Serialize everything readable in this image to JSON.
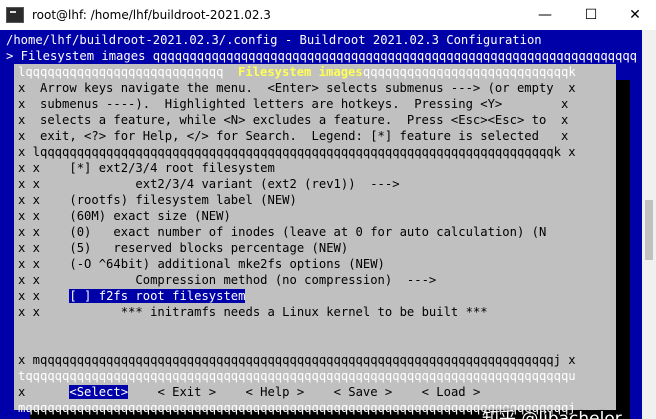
{
  "window": {
    "title": "root@lhf: /home/lhf/buildroot-2021.02.3",
    "min_glyph": "—",
    "max_glyph": "☐",
    "close_glyph": "✕"
  },
  "terminal": {
    "header_line": "/home/lhf/buildroot-2021.02.3/.config - Buildroot 2021.02.3 Configuration",
    "breadcrumb_line": "> Filesystem images qqqqqqqqqqqqqqqqqqqqqqqqqqqqqqqqqqqqqqqqqqqqqqqqqqqqqqqqqqqqqqqqqq"
  },
  "dialog": {
    "top_border_left": "lqqqqqqqqqqqqqqqqqqqqqqqqqqq",
    "title": " Filesystem images ",
    "top_border_right": "qqqqqqqqqqqqqqqqqqqqqqqqqqqqk",
    "help": [
      "x  Arrow keys navigate the menu.  <Enter> selects submenus ---> (or empty  x",
      "x  submenus ----).  Highlighted letters are hotkeys.  Pressing <Y>        x",
      "x  selects a feature, while <N> excludes a feature.  Press <Esc><Esc> to  x",
      "x  exit, <?> for Help, </> for Search.  Legend: [*] feature is selected   x"
    ],
    "inner_top": "x lqqqqqqqqqqqqqqqqqqqqqqqqqqqqqqqqqqqqqqqqqqqqqqqqqqqqqqqqqqqqqqqqqqqqqqk x",
    "items": [
      {
        "marker": "[*]",
        "text": "ext2/3/4 root filesystem"
      },
      {
        "marker": "   ",
        "text": "     ext2/3/4 variant (ext2 (rev1))  --->"
      },
      {
        "marker": "(rootfs)",
        "text": "filesystem label (NEW)"
      },
      {
        "marker": "(60M)",
        "text": "exact size (NEW)"
      },
      {
        "marker": "(0)",
        "text": "  exact number of inodes (leave at 0 for auto calculation) (N"
      },
      {
        "marker": "(5)",
        "text": "  reserved blocks percentage (NEW)"
      },
      {
        "marker": "(-O ^64bit)",
        "text": "additional mke2fs options (NEW)"
      },
      {
        "marker": "   ",
        "text": "     Compression method (no compression)  --->"
      },
      {
        "marker": "[ ]",
        "text": "f2fs root filesystem"
      },
      {
        "marker": "   ",
        "text": "   *** initramfs needs a Linux kernel to be built ***"
      }
    ],
    "inner_bottom": "x mqqqqqqqqqqqqqqqqqqqqqqqqqqqqqqqqqqqqqqqqqqqqqqqqqqqqqqqqqqqqqqqqqqqqqqj x",
    "separator": "tqqqqqqqqqqqqqqqqqqqqqqqqqqqqqqqqqqqqqqqqqqqqqqqqqqqqqqqqqqqqqqqqqqqqqqqqqqu",
    "buttons": {
      "select": "<Select>",
      "exit": "< Exit >",
      "help": "< Help >",
      "save": "< Save >",
      "load": "< Load >"
    },
    "bottom_border": "mqqqqqqqqqqqqqqqqqqqqqqqqqqqqqqqqqqqqqqqqqqqqqqqqqqqqqqqqqqqqqqqqqqqqqqqqqqj"
  },
  "watermark": "知乎 @ljbachelor"
}
